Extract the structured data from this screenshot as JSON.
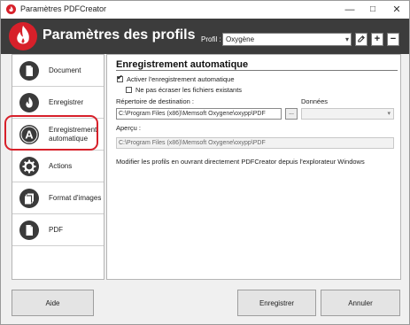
{
  "window": {
    "title": "Paramètres PDFCreator",
    "minimize": "—",
    "maximize": "□",
    "close": "✕"
  },
  "header": {
    "title": "Paramètres des profils",
    "profile_label": "Profil :",
    "profile_value": "Oxygène",
    "add_label": "+",
    "remove_label": "−"
  },
  "sidebar": {
    "items": [
      {
        "label": "Document",
        "icon": "document-icon"
      },
      {
        "label": "Enregistrer",
        "icon": "flame-icon"
      },
      {
        "label": "Enregistrement automatique",
        "icon": "letter-a-icon",
        "selected": true
      },
      {
        "label": "Actions",
        "icon": "gear-icon"
      },
      {
        "label": "Format d'images",
        "icon": "images-icon"
      },
      {
        "label": "PDF",
        "icon": "pdf-file-icon"
      }
    ]
  },
  "main": {
    "section_title": "Enregistrement automatique",
    "enable_auto_label": "Activer l'enregistrement automatique",
    "enable_auto_checked": true,
    "no_overwrite_label": "Ne pas écraser les fichiers existants",
    "no_overwrite_checked": false,
    "target_dir_label": "Répertoire de destination :",
    "target_dir_value": "C:\\Program Files (x86)\\Memsoft Oxygene\\oxypp\\PDF",
    "browse_label": "...",
    "data_label": "Données",
    "preview_label": "Aperçu :",
    "preview_value": "C:\\Program Files (x86)\\Memsoft Oxygene\\oxypp\\PDF",
    "hint_text": "Modifier les profils en ouvrant directement PDFCreator depuis l'explorateur Windows"
  },
  "footer": {
    "help_label": "Aide",
    "save_label": "Enregistrer",
    "cancel_label": "Annuler"
  },
  "colors": {
    "header_bg": "#3c3c3c",
    "brand_red": "#d7202a",
    "selection_ring": "#d7202a"
  }
}
